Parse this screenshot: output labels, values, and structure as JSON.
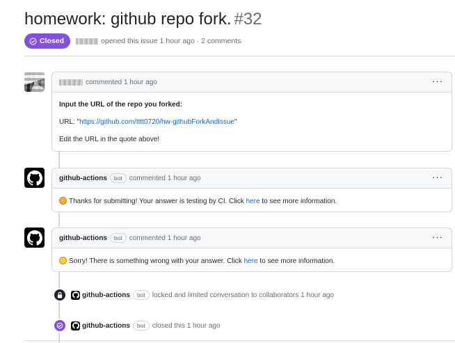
{
  "issue": {
    "title": "homework: github repo fork.",
    "number": "#32",
    "state": "Closed",
    "meta_text": "opened this issue 1 hour ago · 2 comments"
  },
  "comments": [
    {
      "author": "",
      "time": "commented 1 hour ago",
      "body": {
        "line1": "Input the URL of the repo you forked:",
        "url_prefix": "URL: \"",
        "url_link": "https://github.com/tttt0720/hw-githubForkAndIssue",
        "url_suffix": "\"",
        "line3": "Edit the URL in the quote above!"
      }
    },
    {
      "author": "github-actions",
      "bot": "bot",
      "time": "commented 1 hour ago",
      "body": {
        "before": "Thanks for submitting! Your answer is testing by CI. Click ",
        "link": "here",
        "after": " to see more information."
      }
    },
    {
      "author": "github-actions",
      "bot": "bot",
      "time": "commented 1 hour ago",
      "body": {
        "before": "Sorry! There is something wrong with your answer. Click ",
        "link": "here",
        "after": " to see more information."
      }
    }
  ],
  "events": [
    {
      "actor": "github-actions",
      "bot": "bot",
      "text": "locked and limited conversation to collaborators 1 hour ago",
      "icon": "lock-icon"
    },
    {
      "actor": "github-actions",
      "bot": "bot",
      "text": "closed this 1 hour ago",
      "icon": "closed-circle-icon"
    }
  ],
  "menu_glyph": "···",
  "colors": {
    "closed": "#8250df",
    "link": "#0969da",
    "border": "#d0d7de"
  }
}
